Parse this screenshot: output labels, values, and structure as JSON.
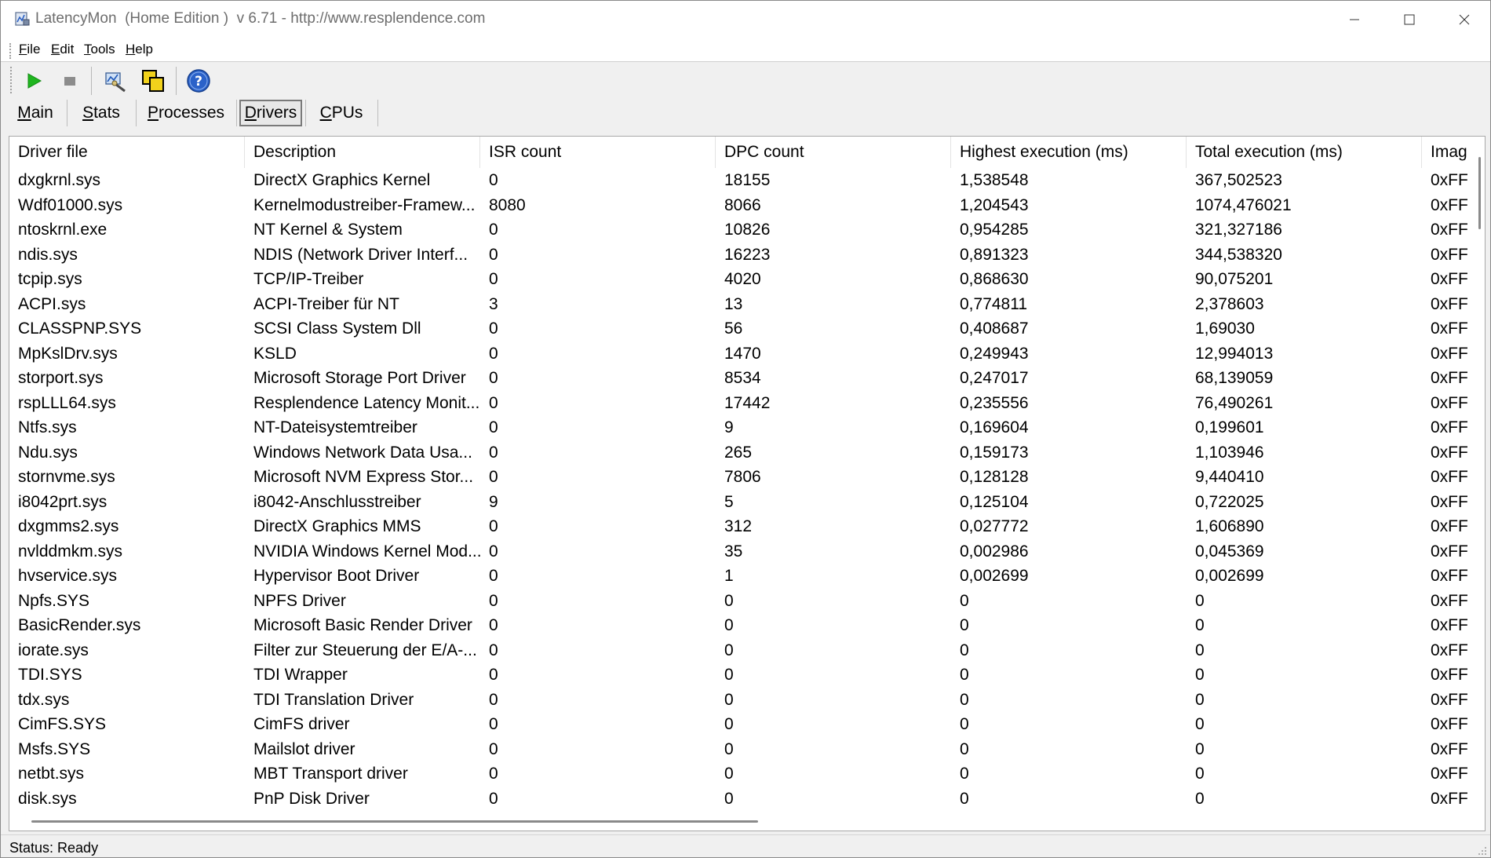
{
  "window": {
    "title": "LatencyMon  (Home Edition )  v 6.71 - http://www.resplendence.com"
  },
  "menu": {
    "file": {
      "ul": "F",
      "rest": "ile"
    },
    "edit": {
      "ul": "E",
      "rest": "dit"
    },
    "tools": {
      "ul": "T",
      "rest": "ools"
    },
    "help": {
      "ul": "H",
      "rest": "elp"
    }
  },
  "toolbar": {
    "icons": [
      "play-icon",
      "stop-icon",
      "tool-icon",
      "copy-icon",
      "help-icon"
    ]
  },
  "tabs": [
    {
      "ul": "M",
      "rest": "ain"
    },
    {
      "ul": "S",
      "rest": "tats"
    },
    {
      "ul": "P",
      "rest": "rocesses"
    },
    {
      "ul": "D",
      "rest": "rivers"
    },
    {
      "ul": "C",
      "rest": "PUs"
    }
  ],
  "active_tab": "Drivers",
  "table": {
    "columns": [
      "Driver file",
      "Description",
      "ISR count",
      "DPC count",
      "Highest execution (ms)",
      "Total execution (ms)",
      "Imag"
    ],
    "rows": [
      [
        "dxgkrnl.sys",
        "DirectX Graphics Kernel",
        "0",
        "18155",
        "1,538548",
        "367,502523",
        "0xFF"
      ],
      [
        "Wdf01000.sys",
        "Kernelmodustreiber-Framew...",
        "8080",
        "8066",
        "1,204543",
        "1074,476021",
        "0xFF"
      ],
      [
        "ntoskrnl.exe",
        "NT Kernel & System",
        "0",
        "10826",
        "0,954285",
        "321,327186",
        "0xFF"
      ],
      [
        "ndis.sys",
        "NDIS (Network Driver Interf...",
        "0",
        "16223",
        "0,891323",
        "344,538320",
        "0xFF"
      ],
      [
        "tcpip.sys",
        "TCP/IP-Treiber",
        "0",
        "4020",
        "0,868630",
        "90,075201",
        "0xFF"
      ],
      [
        "ACPI.sys",
        "ACPI-Treiber für NT",
        "3",
        "13",
        "0,774811",
        "2,378603",
        "0xFF"
      ],
      [
        "CLASSPNP.SYS",
        "SCSI Class System Dll",
        "0",
        "56",
        "0,408687",
        "1,69030",
        "0xFF"
      ],
      [
        "MpKslDrv.sys",
        "KSLD",
        "0",
        "1470",
        "0,249943",
        "12,994013",
        "0xFF"
      ],
      [
        "storport.sys",
        "Microsoft Storage Port Driver",
        "0",
        "8534",
        "0,247017",
        "68,139059",
        "0xFF"
      ],
      [
        "rspLLL64.sys",
        "Resplendence Latency Monit...",
        "0",
        "17442",
        "0,235556",
        "76,490261",
        "0xFF"
      ],
      [
        "Ntfs.sys",
        "NT-Dateisystemtreiber",
        "0",
        "9",
        "0,169604",
        "0,199601",
        "0xFF"
      ],
      [
        "Ndu.sys",
        "Windows Network Data Usa...",
        "0",
        "265",
        "0,159173",
        "1,103946",
        "0xFF"
      ],
      [
        "stornvme.sys",
        "Microsoft NVM Express Stor...",
        "0",
        "7806",
        "0,128128",
        "9,440410",
        "0xFF"
      ],
      [
        "i8042prt.sys",
        "i8042-Anschlusstreiber",
        "9",
        "5",
        "0,125104",
        "0,722025",
        "0xFF"
      ],
      [
        "dxgmms2.sys",
        "DirectX Graphics MMS",
        "0",
        "312",
        "0,027772",
        "1,606890",
        "0xFF"
      ],
      [
        "nvlddmkm.sys",
        "NVIDIA Windows Kernel Mod...",
        "0",
        "35",
        "0,002986",
        "0,045369",
        "0xFF"
      ],
      [
        "hvservice.sys",
        "Hypervisor Boot Driver",
        "0",
        "1",
        "0,002699",
        "0,002699",
        "0xFF"
      ],
      [
        "Npfs.SYS",
        "NPFS Driver",
        "0",
        "0",
        "0",
        "0",
        "0xFF"
      ],
      [
        "BasicRender.sys",
        "Microsoft Basic Render Driver",
        "0",
        "0",
        "0",
        "0",
        "0xFF"
      ],
      [
        "iorate.sys",
        "Filter zur Steuerung der E/A-...",
        "0",
        "0",
        "0",
        "0",
        "0xFF"
      ],
      [
        "TDI.SYS",
        "TDI Wrapper",
        "0",
        "0",
        "0",
        "0",
        "0xFF"
      ],
      [
        "tdx.sys",
        "TDI Translation Driver",
        "0",
        "0",
        "0",
        "0",
        "0xFF"
      ],
      [
        "CimFS.SYS",
        "CimFS driver",
        "0",
        "0",
        "0",
        "0",
        "0xFF"
      ],
      [
        "Msfs.SYS",
        "Mailslot driver",
        "0",
        "0",
        "0",
        "0",
        "0xFF"
      ],
      [
        "netbt.sys",
        "MBT Transport driver",
        "0",
        "0",
        "0",
        "0",
        "0xFF"
      ],
      [
        "disk.sys",
        "PnP Disk Driver",
        "0",
        "0",
        "0",
        "0",
        "0xFF"
      ]
    ]
  },
  "status": {
    "text": "Status: Ready"
  }
}
